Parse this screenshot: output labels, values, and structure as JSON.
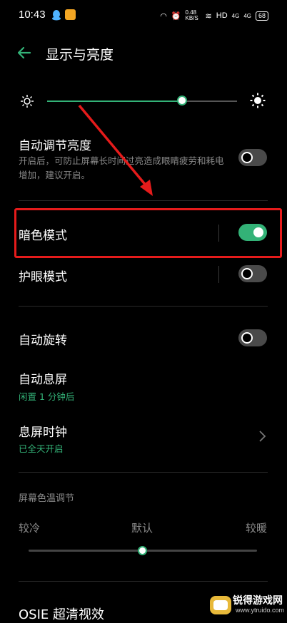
{
  "status_bar": {
    "time": "10:43",
    "net_speed": "0.48 KB/S",
    "hd": "HD",
    "signal1": "4G",
    "signal2": "4G",
    "battery": "68"
  },
  "header": {
    "title": "显示与亮度"
  },
  "brightness": {
    "level_percent": 71
  },
  "auto_brightness": {
    "label": "自动调节亮度",
    "description": "开启后，可防止屏幕长时间过亮造成眼睛疲劳和耗电增加，建议开启。",
    "enabled": false
  },
  "dark_mode": {
    "label": "暗色模式",
    "enabled": true
  },
  "eye_care": {
    "label": "护眼模式",
    "enabled": false
  },
  "auto_rotate": {
    "label": "自动旋转",
    "enabled": false
  },
  "auto_screen_off": {
    "label": "自动息屏",
    "value": "闲置 1 分钟后"
  },
  "aod_clock": {
    "label": "息屏时钟",
    "value": "已全天开启"
  },
  "color_temp": {
    "section_title": "屏幕色温调节",
    "cold_label": "较冷",
    "default_label": "默认",
    "warm_label": "较暖",
    "level_percent": 50
  },
  "osie": {
    "label": "OSIE 超清视效"
  },
  "watermark": {
    "name": "锐得游戏网",
    "url": "www.ytruido.com"
  },
  "colors": {
    "accent": "#33b277",
    "highlight": "#e51b1b",
    "arrow": "#e51b1b"
  }
}
